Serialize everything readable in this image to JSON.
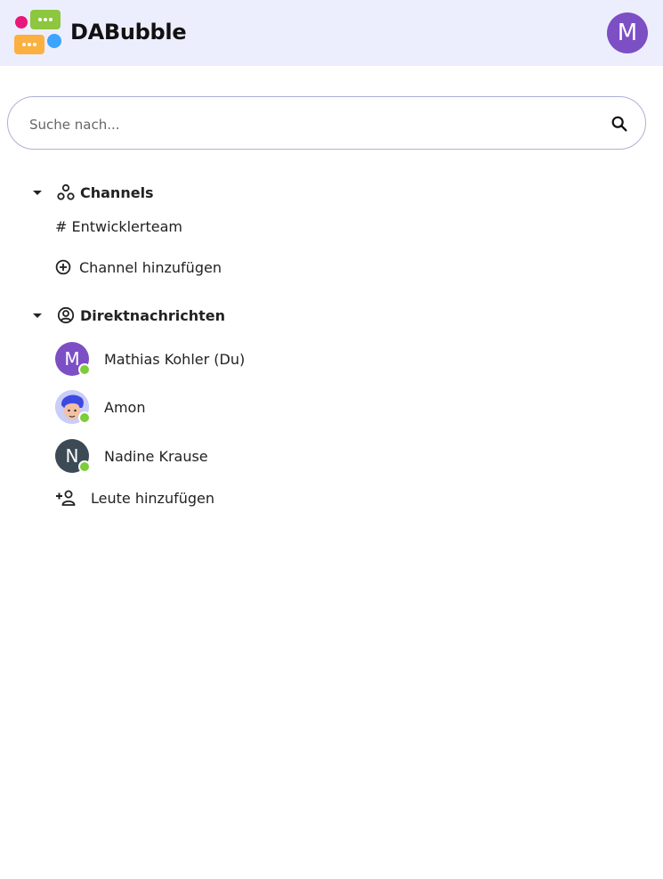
{
  "app": {
    "title": "DABubble"
  },
  "user": {
    "initial": "M",
    "color": "#7c4fc4"
  },
  "search": {
    "placeholder": "Suche nach..."
  },
  "channels": {
    "heading": "Channels",
    "items": [
      {
        "label": "# Entwicklerteam"
      }
    ],
    "add_label": "Channel hinzufügen"
  },
  "direct_messages": {
    "heading": "Direktnachrichten",
    "items": [
      {
        "name": "Mathias Kohler (Du)",
        "initial": "M",
        "avatar_color": "#7c4fc4",
        "status": "online"
      },
      {
        "name": "Amon",
        "initial": "",
        "avatar_color": "#c9cdf7",
        "status": "online"
      },
      {
        "name": "Nadine Krause",
        "initial": "N",
        "avatar_color": "#3c4a56",
        "status": "online"
      }
    ],
    "add_label": "Leute hinzufügen"
  },
  "colors": {
    "header_bg": "#eceefe",
    "online": "#7ccd3a",
    "search_border": "#adb0d9"
  }
}
